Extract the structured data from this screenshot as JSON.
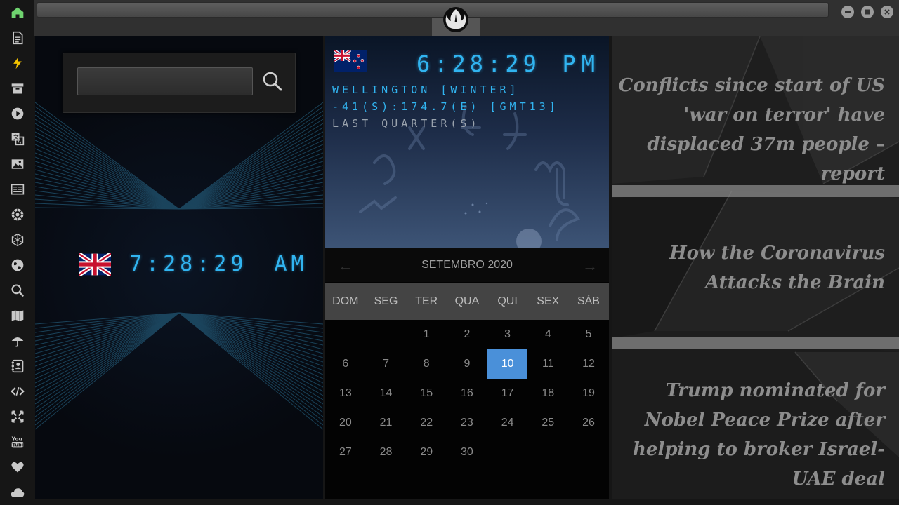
{
  "sidebar": {
    "icons": [
      "home-icon",
      "document-icon",
      "lightning-icon",
      "archive-icon",
      "play-icon",
      "translate-icon",
      "image-icon",
      "newspaper-icon",
      "galactic-empire-icon",
      "hexagon-icon",
      "globe-icon",
      "search-icon",
      "map-icon",
      "umbrella-icon",
      "contacts-icon",
      "code-icon",
      "expand-icon",
      "youtube-icon",
      "heart-icon",
      "cloud-icon"
    ],
    "active_color": "#6fd36f",
    "icon_color": "#c8c8c8"
  },
  "topbar": {
    "logo_icon": "rebel-alliance-icon",
    "window_buttons": [
      "minimize-button",
      "maximize-button",
      "close-button"
    ]
  },
  "left_panel": {
    "search": {
      "value": "",
      "placeholder": ""
    },
    "clock": {
      "flag": "uk-flag-icon",
      "time": "7:28:29",
      "ampm": "AM"
    }
  },
  "nz_clock": {
    "flag": "nz-flag-icon",
    "time": "6:28:29",
    "ampm": "PM",
    "line1": "WELLINGTON [WINTER]",
    "line2": "-41(S):174.7(E) [GMT13]",
    "line3": "LAST QUARTER(S)"
  },
  "calendar": {
    "month_label": "SETEMBRO 2020",
    "weekdays": [
      "DOM",
      "SEG",
      "TER",
      "QUA",
      "QUI",
      "SEX",
      "SÁB"
    ],
    "weeks": [
      [
        "",
        "",
        "1",
        "2",
        "3",
        "4",
        "5"
      ],
      [
        "6",
        "7",
        "8",
        "9",
        "10",
        "11",
        "12"
      ],
      [
        "13",
        "14",
        "15",
        "16",
        "17",
        "18",
        "19"
      ],
      [
        "20",
        "21",
        "22",
        "23",
        "24",
        "25",
        "26"
      ],
      [
        "27",
        "28",
        "29",
        "30",
        "",
        "",
        ""
      ]
    ],
    "today": "10",
    "accent": "#4a90d9"
  },
  "news": [
    "Conflicts since start of US 'war on terror' have displaced 37m people – report",
    "How the Coronavirus Attacks the Brain",
    "Trump nominated for Nobel Peace Prize after helping to broker Israel-UAE deal"
  ],
  "colors": {
    "digital": "#31b4f0",
    "background": "#161616"
  }
}
